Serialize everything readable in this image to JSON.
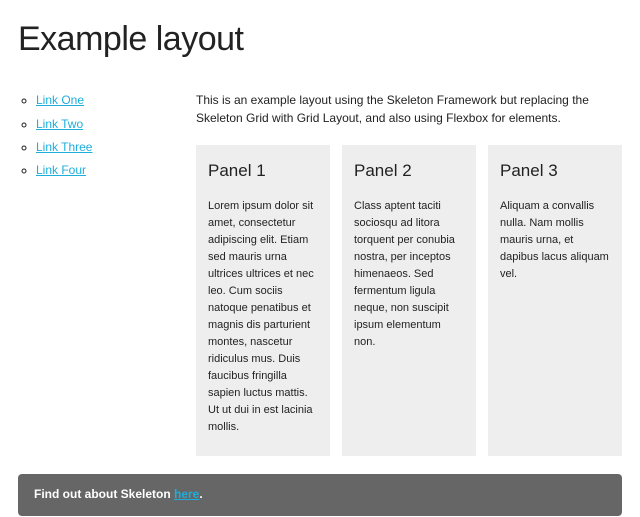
{
  "title": "Example layout",
  "sidebar": {
    "links": [
      {
        "label": "Link One"
      },
      {
        "label": "Link Two"
      },
      {
        "label": "Link Three"
      },
      {
        "label": "Link Four"
      }
    ]
  },
  "main": {
    "intro": "This is an example layout using the Skeleton Framework but replacing the Skeleton Grid with Grid Layout, and also using Flexbox for elements.",
    "panels": [
      {
        "heading": "Panel 1",
        "body": "Lorem ipsum dolor sit amet, consectetur adipiscing elit. Etiam sed mauris urna ultrices ultrices et nec leo. Cum sociis natoque penatibus et magnis dis parturient montes, nascetur ridiculus mus. Duis faucibus fringilla sapien luctus mattis. Ut ut dui in est lacinia mollis."
      },
      {
        "heading": "Panel 2",
        "body": "Class aptent taciti sociosqu ad litora torquent per conubia nostra, per inceptos himenaeos. Sed fermentum ligula neque, non suscipit ipsum elementum non."
      },
      {
        "heading": "Panel 3",
        "body": "Aliquam a convallis nulla. Nam mollis mauris urna, et dapibus lacus aliquam vel."
      }
    ]
  },
  "footer": {
    "prefix": "Find out about Skeleton ",
    "link_label": "here",
    "suffix": "."
  }
}
